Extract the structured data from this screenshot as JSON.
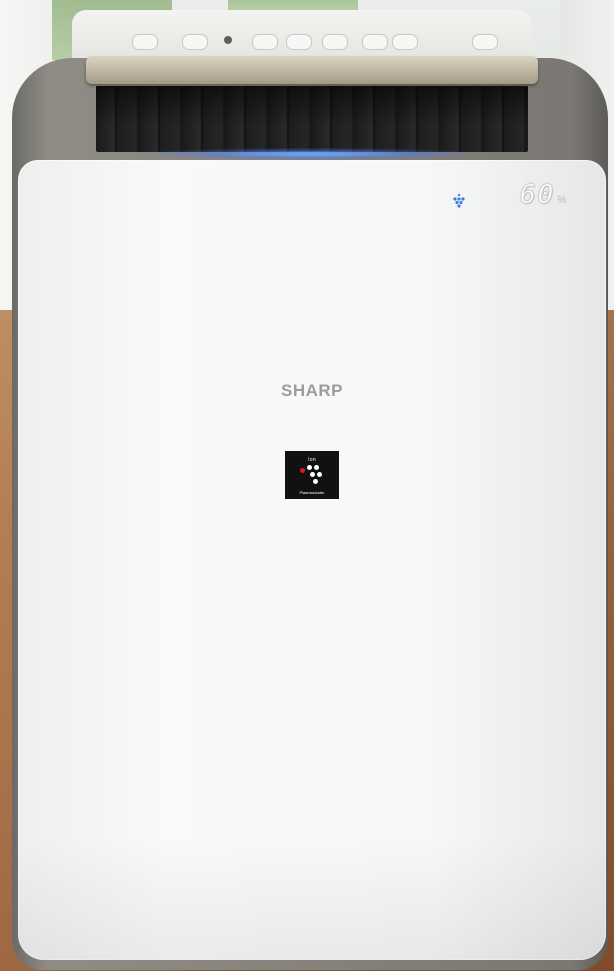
{
  "product": {
    "brand": "SHARP",
    "display_value": "60",
    "display_unit": "%",
    "badge_label": "Ion",
    "badge_sub": "Plasmacluster"
  },
  "colors": {
    "display_glow": "#6eaaff",
    "water_icon": "#3d7fe0",
    "badge_red": "#e0161f",
    "body": "#f6f7f7"
  }
}
